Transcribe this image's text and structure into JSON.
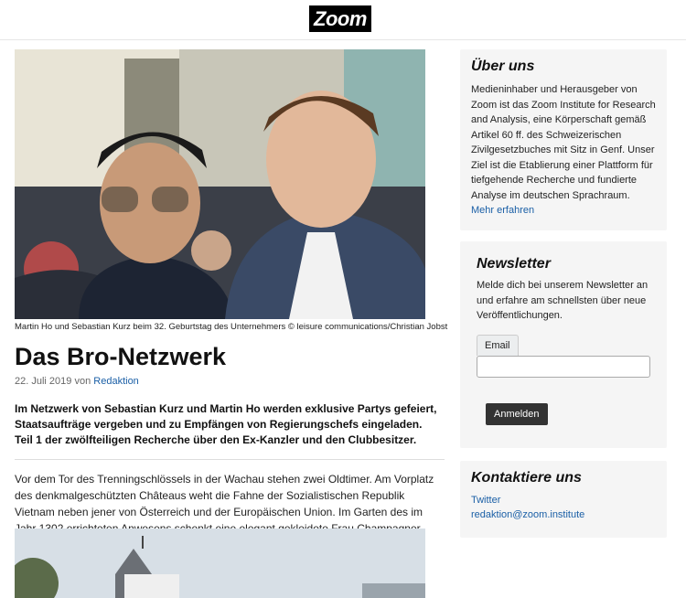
{
  "header": {
    "logo_text": "Zoom"
  },
  "article": {
    "image_caption": "Martin Ho und Sebastian Kurz beim 32. Geburtstag des Unternehmers © leisure communications/Christian Jobst",
    "title": "Das Bro-Netzwerk",
    "date": "22. Juli 2019",
    "by_text": "von",
    "author": "Redaktion",
    "lead": "Im Netzwerk von Sebastian Kurz und Martin Ho werden exklusive Partys gefeiert, Staatsaufträge vergeben und zu Empfängen von Regierungschefs eingeladen. Teil 1 der zwölfteiligen Recherche über den Ex-Kanzler und den Clubbesitzer.",
    "body": "Vor dem Tor des Trenningschlössels in der Wachau stehen zwei Oldtimer. Am Vorplatz des denkmalgeschützten Châteaus weht die Fahne der Sozialistischen Republik Vietnam neben jener von Österreich und der Europäischen Union. Im Garten des im Jahr 1302 errichteten Anwesens schenkt eine elegant gekleidete Frau Champagner aus."
  },
  "sidebar": {
    "about": {
      "title": "Über uns",
      "text": "Medieninhaber und Herausgeber von Zoom ist das Zoom Institute for Research and Analysis, eine Körperschaft gemäß Artikel 60 ff. des Schweizerischen Zivilgesetzbuches mit Sitz in Genf. Unser Ziel ist die Etablierung einer Plattform für tiefgehende Recherche und fundierte Analyse im deutschen Sprachraum.",
      "link": "Mehr erfahren"
    },
    "newsletter": {
      "title": "Newsletter",
      "text": "Melde dich bei unserem Newsletter an und erfahre am schnellsten über neue Veröffentlichungen.",
      "email_label": "Email",
      "email_value": "",
      "submit_label": "Anmelden"
    },
    "contact": {
      "title": "Kontaktiere uns",
      "twitter": "Twitter",
      "email": "redaktion@zoom.institute"
    }
  },
  "colors": {
    "link": "#1a5fa6",
    "button": "#333333",
    "card_bg": "#f5f5f5"
  }
}
